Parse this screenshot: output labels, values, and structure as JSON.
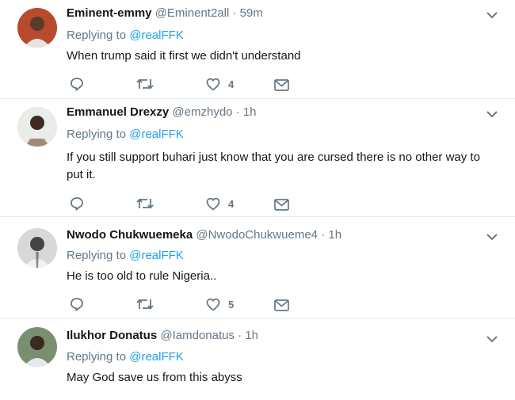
{
  "reply_label": "Replying to",
  "tweets": [
    {
      "name": "Eminent-emmy",
      "handle": "@Eminent2all",
      "dot": "·",
      "time": "59m",
      "replying_to": "@realFFK",
      "text": "When trump said it first we didn't understand",
      "likes": "4"
    },
    {
      "name": "Emmanuel Drexzy",
      "handle": "@emzhydo",
      "dot": "·",
      "time": "1h",
      "replying_to": "@realFFK",
      "text": "If you still support buhari just know that you are cursed there is no other way to put it.",
      "likes": "4"
    },
    {
      "name": "Nwodo Chukwuemeka",
      "handle": "@NwodoChukwueme4",
      "dot": "·",
      "time": "1h",
      "replying_to": "@realFFK",
      "text": "He is too old to rule Nigeria..",
      "likes": "5"
    },
    {
      "name": "Ilukhor Donatus",
      "handle": "@Iamdonatus",
      "dot": "·",
      "time": "1h",
      "replying_to": "@realFFK",
      "text": "May God save us from this abyss",
      "likes": ""
    }
  ],
  "colors": {
    "link": "#1da1f2",
    "muted": "#657786",
    "divider": "#e6ecf0"
  },
  "icons": [
    "reply-icon",
    "retweet-icon",
    "like-icon",
    "direct-message-icon",
    "chevron-down-icon"
  ]
}
